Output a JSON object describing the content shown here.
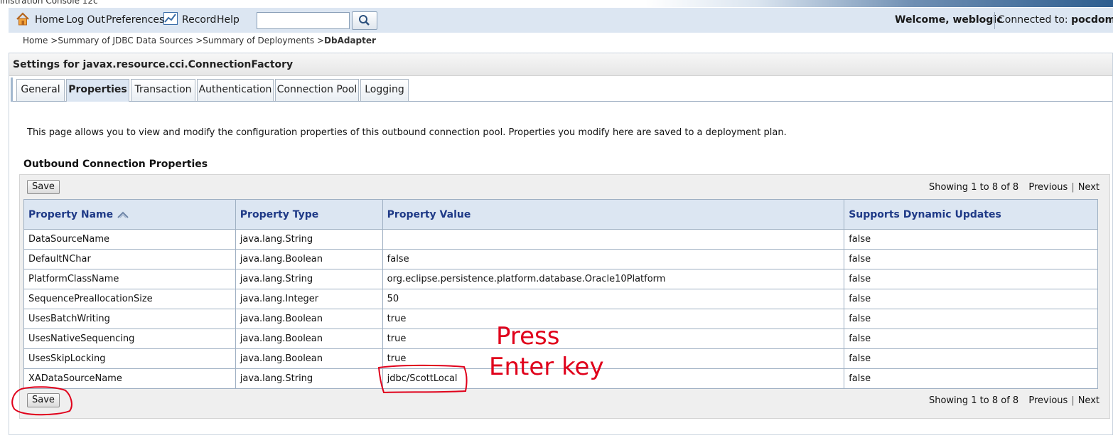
{
  "window": {
    "title_partial": "inistration Console 12c"
  },
  "toolbar": {
    "home": "Home",
    "logout": "Log Out",
    "preferences": "Preferences",
    "record": "Record",
    "help": "Help",
    "search_value": "",
    "welcome_prefix": "Welcome,",
    "user": "weblogic",
    "connected_prefix": "Connected to:",
    "domain": "pocdomai"
  },
  "breadcrumb": {
    "items": [
      "Home >",
      "Summary of JDBC Data Sources >",
      "Summary of Deployments >"
    ],
    "current": "DbAdapter"
  },
  "settings": {
    "title": "Settings for javax.resource.cci.ConnectionFactory",
    "tabs": [
      "General",
      "Properties",
      "Transaction",
      "Authentication",
      "Connection Pool",
      "Logging"
    ],
    "active_tab": "Properties",
    "description": "This page allows you to view and modify the configuration properties of this outbound connection pool. Properties you modify here are saved to a deployment plan."
  },
  "outbound": {
    "section_title": "Outbound Connection Properties",
    "save_label": "Save",
    "paging": {
      "showing": "Showing 1 to 8 of 8",
      "previous": "Previous",
      "next": "Next"
    },
    "columns": [
      "Property Name",
      "Property Type",
      "Property Value",
      "Supports Dynamic Updates"
    ],
    "rows": [
      [
        "DataSourceName",
        "java.lang.String",
        "",
        "false"
      ],
      [
        "DefaultNChar",
        "java.lang.Boolean",
        "false",
        "false"
      ],
      [
        "PlatformClassName",
        "java.lang.String",
        "org.eclipse.persistence.platform.database.Oracle10Platform",
        "false"
      ],
      [
        "SequencePreallocationSize",
        "java.lang.Integer",
        "50",
        "false"
      ],
      [
        "UsesBatchWriting",
        "java.lang.Boolean",
        "true",
        "false"
      ],
      [
        "UsesNativeSequencing",
        "java.lang.Boolean",
        "true",
        "false"
      ],
      [
        "UsesSkipLocking",
        "java.lang.Boolean",
        "true",
        "false"
      ],
      [
        "XADataSourceName",
        "java.lang.String",
        "jdbc/ScottLocal",
        "false"
      ]
    ]
  },
  "annotation": {
    "line1": "Press",
    "line2": "Enter key",
    "color": "#e0001b"
  },
  "colors": {
    "toolbar_bg": "#dce6f2",
    "header_text": "#1f3a87",
    "grid_line": "#9fb0c3"
  }
}
